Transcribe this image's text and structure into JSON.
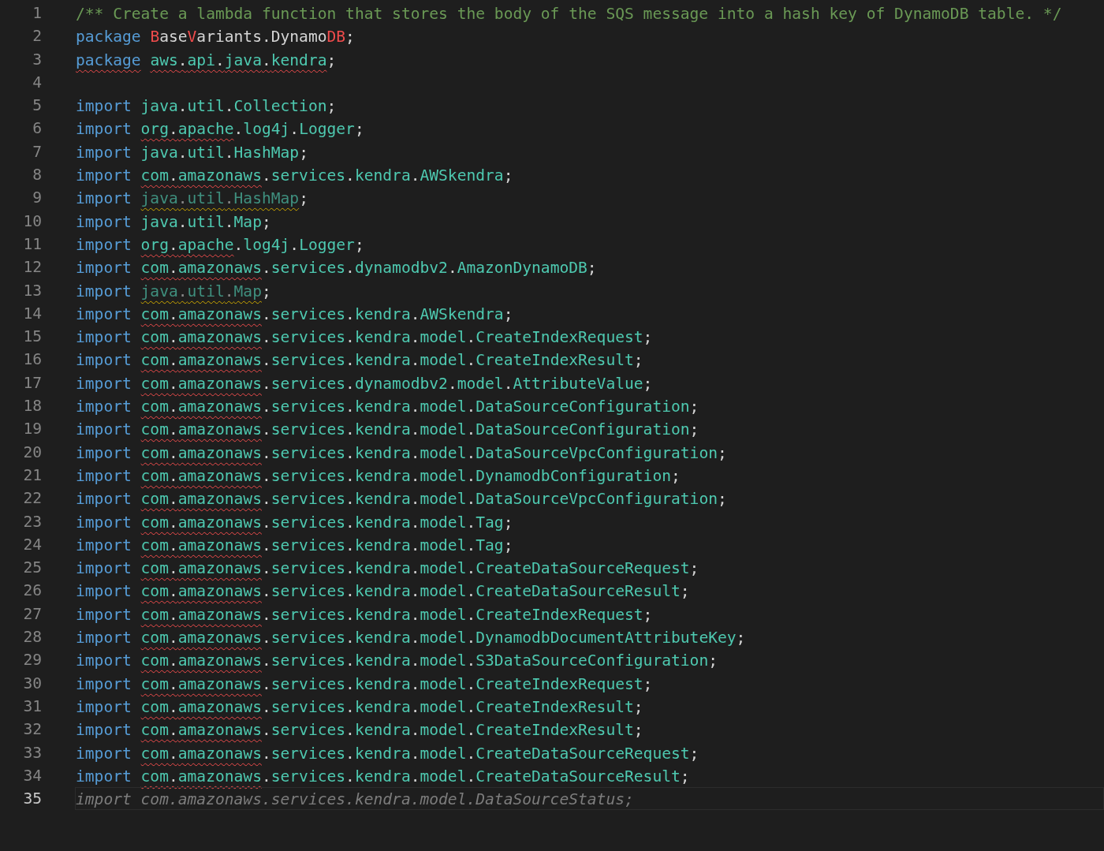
{
  "editor": {
    "lines": [
      {
        "number": "1",
        "current": false,
        "parts": [
          {
            "text": "/** Create a lambda function that stores the body of the SQS message into a hash key of DynamoDB table. */",
            "kind": "comment"
          }
        ]
      },
      {
        "number": "2",
        "current": false,
        "parts": [
          {
            "text": "package ",
            "kind": "keyword"
          },
          {
            "text": "B",
            "kind": "error"
          },
          {
            "text": "ase",
            "kind": "plain"
          },
          {
            "text": "V",
            "kind": "error"
          },
          {
            "text": "ariants.Dynamo",
            "kind": "plain"
          },
          {
            "text": "DB",
            "kind": "error"
          },
          {
            "text": ";",
            "kind": "punct"
          }
        ]
      },
      {
        "number": "3",
        "current": false,
        "parts": [
          {
            "text": "package",
            "kind": "keyword",
            "squiggled": true
          },
          {
            "text": " aws.api.java.kendra",
            "kind": "path",
            "squiggled": true
          },
          {
            "text": ";",
            "kind": "punct"
          }
        ]
      },
      {
        "number": "4",
        "current": false
      },
      {
        "number": "5",
        "current": false,
        "parts": [
          {
            "text": "import ",
            "kind": "keyword"
          },
          {
            "text": "java.util.Collection",
            "kind": "path"
          },
          {
            "text": ";",
            "kind": "punct"
          }
        ]
      },
      {
        "number": "6",
        "current": false,
        "parts": [
          {
            "text": "import ",
            "kind": "keyword"
          },
          {
            "text": "org.apache",
            "kind": "path",
            "squiggled": true
          },
          {
            "text": ".log4j.Logger",
            "kind": "path"
          },
          {
            "text": ";",
            "kind": "punct"
          }
        ]
      },
      {
        "number": "7",
        "current": false,
        "parts": [
          {
            "text": "import ",
            "kind": "keyword"
          },
          {
            "text": "java.util.HashMap",
            "kind": "path"
          },
          {
            "text": ";",
            "kind": "punct"
          }
        ]
      },
      {
        "number": "8",
        "current": false,
        "parts": [
          {
            "text": "import ",
            "kind": "keyword"
          },
          {
            "text": "com.amazonaws",
            "kind": "path",
            "squiggled": true
          },
          {
            "text": ".services.kendra.AWSkendra",
            "kind": "path"
          },
          {
            "text": ";",
            "kind": "punct"
          }
        ]
      },
      {
        "number": "9",
        "current": false,
        "parts": [
          {
            "text": "import ",
            "kind": "keyword"
          },
          {
            "text": "java.util.HashMap",
            "kind": "unused",
            "squiggled": true
          },
          {
            "text": ";",
            "kind": "punct"
          }
        ]
      },
      {
        "number": "10",
        "current": false,
        "parts": [
          {
            "text": "import ",
            "kind": "keyword"
          },
          {
            "text": "java.util.Map",
            "kind": "path"
          },
          {
            "text": ";",
            "kind": "punct"
          }
        ]
      },
      {
        "number": "11",
        "current": false,
        "parts": [
          {
            "text": "import ",
            "kind": "keyword"
          },
          {
            "text": "org.apache",
            "kind": "path",
            "squiggled": true
          },
          {
            "text": ".log4j.Logger",
            "kind": "path"
          },
          {
            "text": ";",
            "kind": "punct"
          }
        ]
      },
      {
        "number": "12",
        "current": false,
        "parts": [
          {
            "text": "import ",
            "kind": "keyword"
          },
          {
            "text": "com.amazonaws",
            "kind": "path",
            "squiggled": true
          },
          {
            "text": ".services.dynamodbv2.AmazonDynamoDB",
            "kind": "path"
          },
          {
            "text": ";",
            "kind": "punct"
          }
        ]
      },
      {
        "number": "13",
        "current": false,
        "parts": [
          {
            "text": "import ",
            "kind": "keyword"
          },
          {
            "text": "java.util.Map",
            "kind": "unused",
            "squiggled": true
          },
          {
            "text": ";",
            "kind": "punct"
          }
        ]
      },
      {
        "number": "14",
        "current": false,
        "parts": [
          {
            "text": "import ",
            "kind": "keyword"
          },
          {
            "text": "com.amazonaws",
            "kind": "path",
            "squiggled": true
          },
          {
            "text": ".services.kendra.AWSkendra",
            "kind": "path"
          },
          {
            "text": ";",
            "kind": "punct"
          }
        ]
      },
      {
        "number": "15",
        "current": false,
        "parts": [
          {
            "text": "import ",
            "kind": "keyword"
          },
          {
            "text": "com.amazonaws",
            "kind": "path",
            "squiggled": true
          },
          {
            "text": ".services.kendra.model.CreateIndexRequest",
            "kind": "path"
          },
          {
            "text": ";",
            "kind": "punct"
          }
        ]
      },
      {
        "number": "16",
        "current": false,
        "parts": [
          {
            "text": "import ",
            "kind": "keyword"
          },
          {
            "text": "com.amazonaws",
            "kind": "path",
            "squiggled": true
          },
          {
            "text": ".services.kendra.model.CreateIndexResult",
            "kind": "path"
          },
          {
            "text": ";",
            "kind": "punct"
          }
        ]
      },
      {
        "number": "17",
        "current": false,
        "parts": [
          {
            "text": "import ",
            "kind": "keyword"
          },
          {
            "text": "com.amazonaws",
            "kind": "path",
            "squiggled": true
          },
          {
            "text": ".services.dynamodbv2.model.AttributeValue",
            "kind": "path"
          },
          {
            "text": ";",
            "kind": "punct"
          }
        ]
      },
      {
        "number": "18",
        "current": false,
        "parts": [
          {
            "text": "import ",
            "kind": "keyword"
          },
          {
            "text": "com.amazonaws",
            "kind": "path",
            "squiggled": true
          },
          {
            "text": ".services.kendra.model.DataSourceConfiguration",
            "kind": "path"
          },
          {
            "text": ";",
            "kind": "punct"
          }
        ]
      },
      {
        "number": "19",
        "current": false,
        "parts": [
          {
            "text": "import ",
            "kind": "keyword"
          },
          {
            "text": "com.amazonaws",
            "kind": "path",
            "squiggled": true
          },
          {
            "text": ".services.kendra.model.DataSourceConfiguration",
            "kind": "path"
          },
          {
            "text": ";",
            "kind": "punct"
          }
        ]
      },
      {
        "number": "20",
        "current": false,
        "parts": [
          {
            "text": "import ",
            "kind": "keyword"
          },
          {
            "text": "com.amazonaws",
            "kind": "path",
            "squiggled": true
          },
          {
            "text": ".services.kendra.model.DataSourceVpcConfiguration",
            "kind": "path"
          },
          {
            "text": ";",
            "kind": "punct"
          }
        ]
      },
      {
        "number": "21",
        "current": false,
        "parts": [
          {
            "text": "import ",
            "kind": "keyword"
          },
          {
            "text": "com.amazonaws",
            "kind": "path",
            "squiggled": true
          },
          {
            "text": ".services.kendra.model.DynamodbConfiguration",
            "kind": "path"
          },
          {
            "text": ";",
            "kind": "punct"
          }
        ]
      },
      {
        "number": "22",
        "current": false,
        "parts": [
          {
            "text": "import ",
            "kind": "keyword"
          },
          {
            "text": "com.amazonaws",
            "kind": "path",
            "squiggled": true
          },
          {
            "text": ".services.kendra.model.DataSourceVpcConfiguration",
            "kind": "path"
          },
          {
            "text": ";",
            "kind": "punct"
          }
        ]
      },
      {
        "number": "23",
        "current": false,
        "parts": [
          {
            "text": "import ",
            "kind": "keyword"
          },
          {
            "text": "com.amazonaws",
            "kind": "path",
            "squiggled": true
          },
          {
            "text": ".services.kendra.model.Tag",
            "kind": "path"
          },
          {
            "text": ";",
            "kind": "punct"
          }
        ]
      },
      {
        "number": "24",
        "current": false,
        "parts": [
          {
            "text": "import ",
            "kind": "keyword"
          },
          {
            "text": "com.amazonaws",
            "kind": "path",
            "squiggled": true
          },
          {
            "text": ".services.kendra.model.Tag",
            "kind": "path"
          },
          {
            "text": ";",
            "kind": "punct"
          }
        ]
      },
      {
        "number": "25",
        "current": false,
        "parts": [
          {
            "text": "import ",
            "kind": "keyword"
          },
          {
            "text": "com.amazonaws",
            "kind": "path",
            "squiggled": true
          },
          {
            "text": ".services.kendra.model.CreateDataSourceRequest",
            "kind": "path"
          },
          {
            "text": ";",
            "kind": "punct"
          }
        ]
      },
      {
        "number": "26",
        "current": false,
        "parts": [
          {
            "text": "import ",
            "kind": "keyword"
          },
          {
            "text": "com.amazonaws",
            "kind": "path",
            "squiggled": true
          },
          {
            "text": ".services.kendra.model.CreateDataSourceResult",
            "kind": "path"
          },
          {
            "text": ";",
            "kind": "punct"
          }
        ]
      },
      {
        "number": "27",
        "current": false,
        "parts": [
          {
            "text": "import ",
            "kind": "keyword"
          },
          {
            "text": "com.amazonaws",
            "kind": "path",
            "squiggled": true
          },
          {
            "text": ".services.kendra.model.CreateIndexRequest",
            "kind": "path"
          },
          {
            "text": ";",
            "kind": "punct"
          }
        ]
      },
      {
        "number": "28",
        "current": false,
        "parts": [
          {
            "text": "import ",
            "kind": "keyword"
          },
          {
            "text": "com.amazonaws",
            "kind": "path",
            "squiggled": true
          },
          {
            "text": ".services.kendra.model.DynamodbDocumentAttributeKey",
            "kind": "path"
          },
          {
            "text": ";",
            "kind": "punct"
          }
        ]
      },
      {
        "number": "29",
        "current": false,
        "parts": [
          {
            "text": "import ",
            "kind": "keyword"
          },
          {
            "text": "com.amazonaws",
            "kind": "path",
            "squiggled": true
          },
          {
            "text": ".services.kendra.model.S3DataSourceConfiguration",
            "kind": "path"
          },
          {
            "text": ";",
            "kind": "punct"
          }
        ]
      },
      {
        "number": "30",
        "current": false,
        "parts": [
          {
            "text": "import ",
            "kind": "keyword"
          },
          {
            "text": "com.amazonaws",
            "kind": "path",
            "squiggled": true
          },
          {
            "text": ".services.kendra.model.CreateIndexRequest",
            "kind": "path"
          },
          {
            "text": ";",
            "kind": "punct"
          }
        ]
      },
      {
        "number": "31",
        "current": false,
        "parts": [
          {
            "text": "import ",
            "kind": "keyword"
          },
          {
            "text": "com.amazonaws",
            "kind": "path",
            "squiggled": true
          },
          {
            "text": ".services.kendra.model.CreateIndexResult",
            "kind": "path"
          },
          {
            "text": ";",
            "kind": "punct"
          }
        ]
      },
      {
        "number": "32",
        "current": false,
        "parts": [
          {
            "text": "import ",
            "kind": "keyword"
          },
          {
            "text": "com.amazonaws",
            "kind": "path",
            "squiggled": true
          },
          {
            "text": ".services.kendra.model.CreateIndexResult",
            "kind": "path"
          },
          {
            "text": ";",
            "kind": "punct"
          }
        ]
      },
      {
        "number": "33",
        "current": false,
        "parts": [
          {
            "text": "import ",
            "kind": "keyword"
          },
          {
            "text": "com.amazonaws",
            "kind": "path",
            "squiggled": true
          },
          {
            "text": ".services.kendra.model.CreateDataSourceRequest",
            "kind": "path"
          },
          {
            "text": ";",
            "kind": "punct"
          }
        ]
      },
      {
        "number": "34",
        "current": false,
        "parts": [
          {
            "text": "import ",
            "kind": "keyword"
          },
          {
            "text": "com.amazonaws",
            "kind": "path",
            "squiggled": true
          },
          {
            "text": ".services.kendra.model.CreateDataSourceResult",
            "kind": "path"
          },
          {
            "text": ";",
            "kind": "punct"
          }
        ]
      },
      {
        "number": "35",
        "current": true,
        "parts": [
          {
            "text": "import com.amazonaws.services.kendra.model.DataSourceStatus;",
            "kind": "ghost"
          }
        ]
      }
    ]
  }
}
